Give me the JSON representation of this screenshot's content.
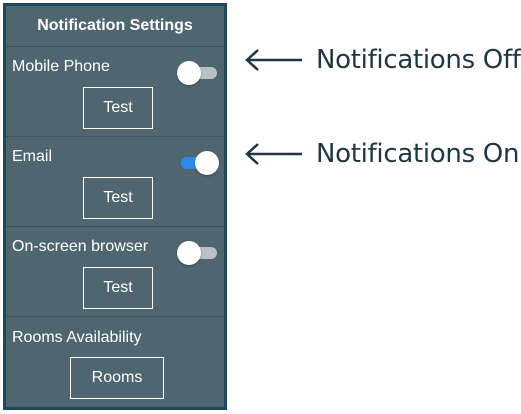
{
  "panel": {
    "title": "Notification Settings",
    "sections": [
      {
        "label": "Mobile Phone",
        "toggle_state": "off",
        "button_label": "Test"
      },
      {
        "label": "Email",
        "toggle_state": "on",
        "button_label": "Test"
      },
      {
        "label": "On-screen browser",
        "toggle_state": "off",
        "button_label": "Test"
      },
      {
        "label": "Rooms Availability",
        "button_label": "Rooms"
      }
    ]
  },
  "annotations": {
    "off_text": "Notifications Off",
    "on_text": "Notifications On"
  },
  "colors": {
    "panel_bg": "#4f6670",
    "panel_border": "#1c4a5c",
    "toggle_on": "#2d8be8",
    "toggle_off_track": "#b8c2c6",
    "annotation_text": "#1f3742"
  },
  "icons": [
    "arrow-left-icon"
  ]
}
